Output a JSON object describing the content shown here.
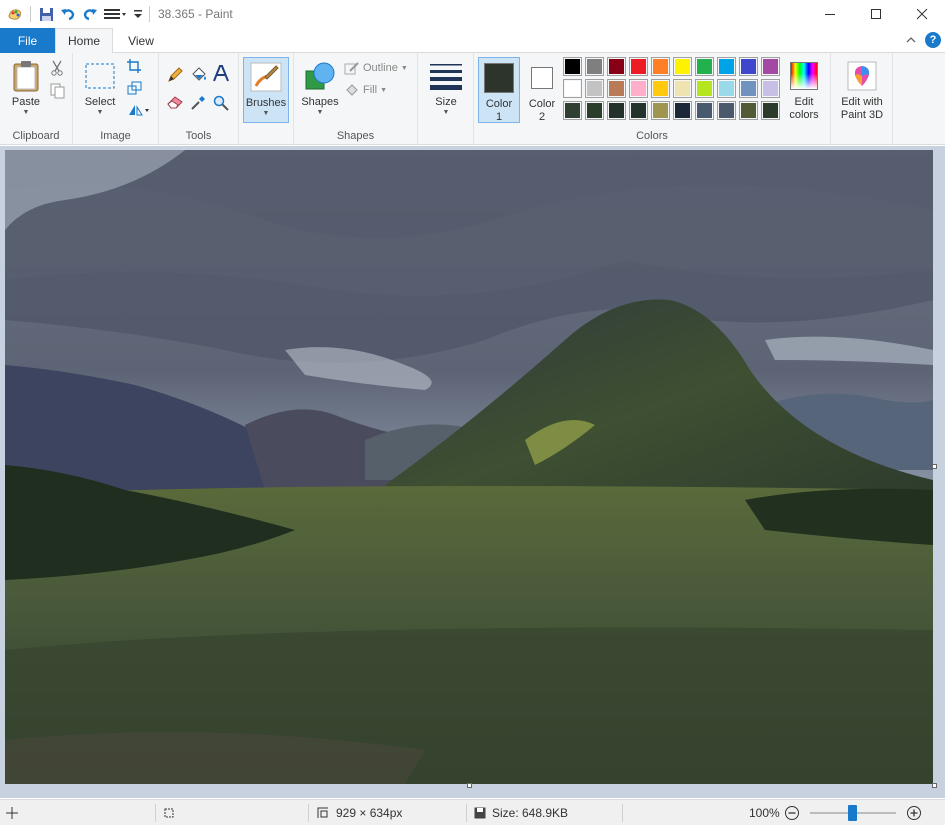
{
  "window": {
    "title": "38.365 - Paint"
  },
  "tabs": {
    "file": "File",
    "home": "Home",
    "view": "View"
  },
  "clipboard": {
    "paste": "Paste",
    "label": "Clipboard"
  },
  "image": {
    "select": "Select",
    "label": "Image"
  },
  "tools": {
    "label": "Tools"
  },
  "brushes": {
    "label": "Brushes"
  },
  "shapes": {
    "shapes": "Shapes",
    "outline": "Outline",
    "fill": "Fill",
    "label": "Shapes"
  },
  "size": {
    "label": "Size"
  },
  "colors": {
    "color1": "Color",
    "color1_num": "1",
    "color2": "Color",
    "color2_num": "2",
    "edit": "Edit",
    "edit2": "colors",
    "label": "Colors",
    "color1_value": "#2c342c",
    "color2_value": "#ffffff",
    "palette": [
      "#000000",
      "#7f7f7f",
      "#880015",
      "#ed1c24",
      "#ff7f27",
      "#fff200",
      "#22b14c",
      "#00a2e8",
      "#3f48cc",
      "#a349a4",
      "#ffffff",
      "#c3c3c3",
      "#b97a57",
      "#ffaec9",
      "#ffc90e",
      "#efe4b0",
      "#b5e61d",
      "#99d9ea",
      "#7092be",
      "#c8bfe7",
      "#2f3f31",
      "#2b3d2b",
      "#24302a",
      "#23342c",
      "#a09550",
      "#1c2838",
      "#4a5a6e",
      "#4a5a6c",
      "#525a36",
      "#2c3a2c"
    ]
  },
  "paint3d": {
    "line1": "Edit with",
    "line2": "Paint 3D"
  },
  "status": {
    "dimensions": "929 × 634px",
    "filesize": "Size: 648.9KB",
    "zoom": "100%",
    "zoom_minus": "−",
    "zoom_plus": "+"
  }
}
